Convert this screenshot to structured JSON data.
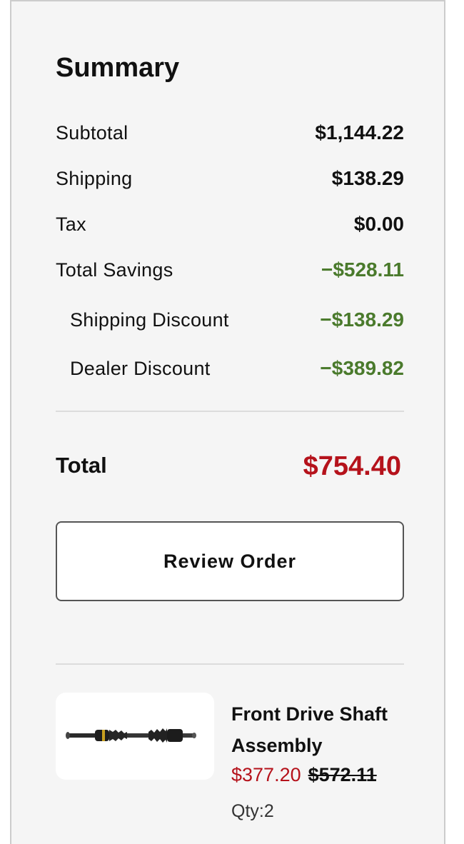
{
  "summary": {
    "title": "Summary",
    "rows": [
      {
        "label": "Subtotal",
        "value": "$1,144.22"
      },
      {
        "label": "Shipping",
        "value": "$138.29"
      },
      {
        "label": "Tax",
        "value": "$0.00"
      },
      {
        "label": "Total Savings",
        "value": "−$528.11"
      },
      {
        "label": "Shipping Discount",
        "value": "−$138.29"
      },
      {
        "label": "Dealer Discount",
        "value": "−$389.82"
      }
    ],
    "total_label": "Total",
    "total_value": "$754.40",
    "review_button": "Review Order"
  },
  "product": {
    "image_icon": "drive-shaft-image",
    "name": "Front Drive Shaft Assembly",
    "sale_price": "$377.20",
    "original_price": "$572.11",
    "qty": "Qty:2"
  },
  "colors": {
    "savings": "#4a7a2c",
    "accent_red": "#b5121b",
    "panel_bg": "#f5f5f5"
  }
}
